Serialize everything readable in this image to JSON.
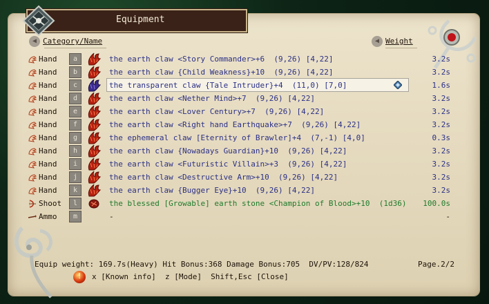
{
  "title": "Equipment",
  "header": {
    "category": "Category/Name",
    "weight": "Weight"
  },
  "rows": [
    {
      "slot": "Hand",
      "key": "a",
      "name": "the earth claw <Story Commander>+6  (9,26) [4,22]",
      "weight": "3.2s"
    },
    {
      "slot": "Hand",
      "key": "b",
      "name": "the earth claw {Child Weakness}+10  (9,26) [4,22]",
      "weight": "3.2s"
    },
    {
      "slot": "Hand",
      "key": "c",
      "name": "the transparent claw {Tale Intruder}+4  (11,0) [7,0]",
      "weight": "1.6s"
    },
    {
      "slot": "Hand",
      "key": "d",
      "name": "the earth claw <Nether Mind>+7  (9,26) [4,22]",
      "weight": "3.2s"
    },
    {
      "slot": "Hand",
      "key": "e",
      "name": "the earth claw <Lover Century>+7  (9,26) [4,22]",
      "weight": "3.2s"
    },
    {
      "slot": "Hand",
      "key": "f",
      "name": "the earth claw <Right hand Earthquake>+7  (9,26) [4,22]",
      "weight": "3.2s"
    },
    {
      "slot": "Hand",
      "key": "g",
      "name": "the ephemeral claw [Eternity of Brawler]+4  (7,-1) [4,0]",
      "weight": "0.3s"
    },
    {
      "slot": "Hand",
      "key": "h",
      "name": "the earth claw {Nowadays Guardian}+10  (9,26) [4,22]",
      "weight": "3.2s"
    },
    {
      "slot": "Hand",
      "key": "i",
      "name": "the earth claw <Futuristic Villain>+3  (9,26) [4,22]",
      "weight": "3.2s"
    },
    {
      "slot": "Hand",
      "key": "j",
      "name": "the earth claw <Destructive Arm>+10  (9,26) [4,22]",
      "weight": "3.2s"
    },
    {
      "slot": "Hand",
      "key": "k",
      "name": "the earth claw {Bugger Eye}+10  (9,26) [4,22]",
      "weight": "3.2s"
    },
    {
      "slot": "Shoot",
      "key": "l",
      "name": "the blessed [Growable] earth stone <Champion of Blood>+10  (1d36)",
      "weight": "100.0s"
    },
    {
      "slot": "Ammo",
      "key": "m",
      "name": "-",
      "weight": "-"
    }
  ],
  "selected_row_key": "c",
  "status": "Equip weight: 169.7s(Heavy) Hit Bonus:368 Damage Bonus:705  DV/PV:128/824",
  "page": "Page.2/2",
  "help": "x [Known info]  z [Mode]  Shift,Esc [Close]",
  "help_icon_glyph": "!",
  "colors": {
    "item_text": "#2a2f86",
    "shoot_text": "#1f7a2c",
    "parchment": "#e4d9bd",
    "title_plate": "#3a2218"
  }
}
